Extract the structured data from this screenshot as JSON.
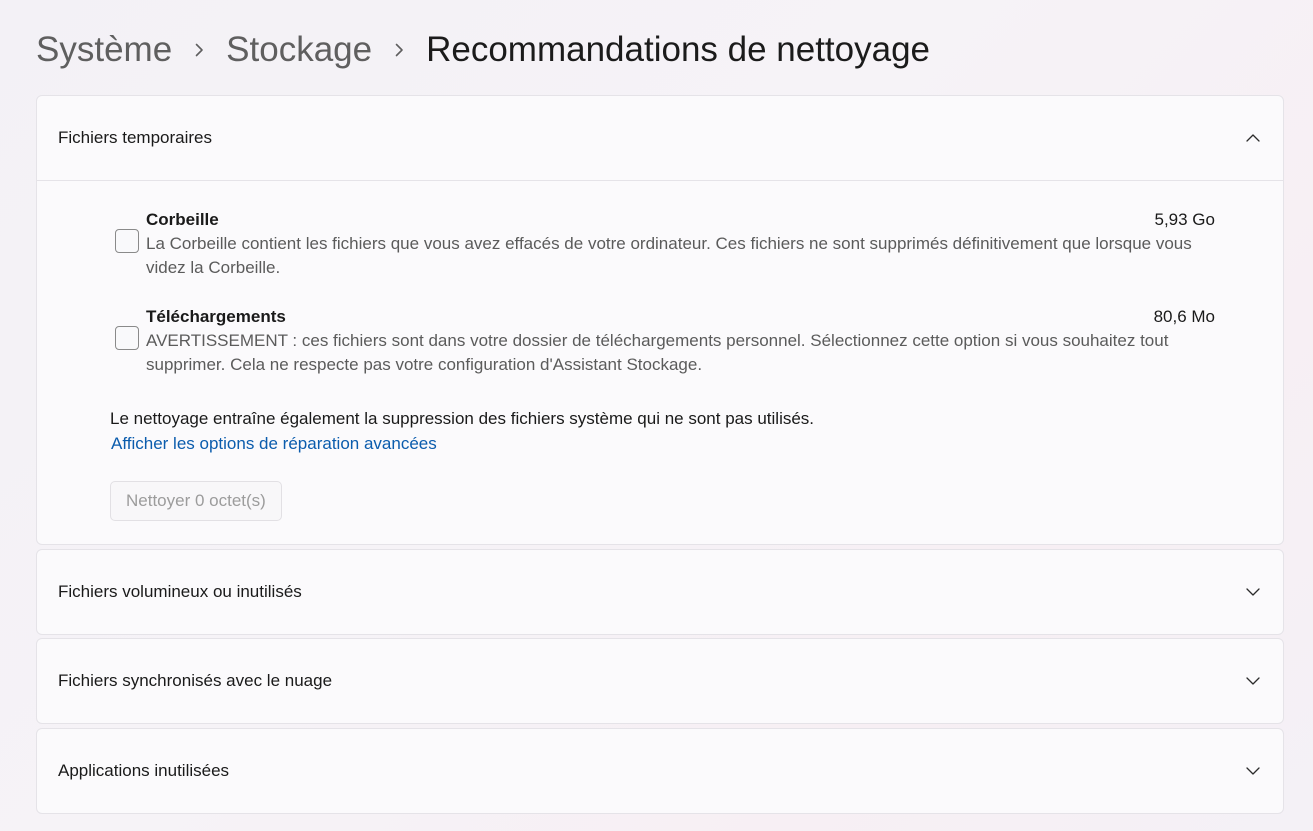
{
  "breadcrumb": {
    "items": [
      "Système",
      "Stockage",
      "Recommandations de nettoyage"
    ],
    "separator_icon": "chevron-right-icon"
  },
  "sections": [
    {
      "title": "Fichiers temporaires",
      "expanded": true,
      "items": [
        {
          "title": "Corbeille",
          "size": "5,93 Go",
          "description_lines": [
            "La Corbeille contient les fichiers que vous avez effacés de votre ordinateur. Ces fichiers ne sont supprimés définitivement que lorsque vous",
            "videz la Corbeille."
          ],
          "checked": false
        },
        {
          "title": "Téléchargements",
          "size": "80,6 Mo",
          "description_lines": [
            "AVERTISSEMENT : ces fichiers sont dans votre dossier de téléchargements personnel. Sélectionnez cette option si vous souhaitez tout",
            "supprimer. Cela ne respecte pas votre configuration d'Assistant Stockage."
          ],
          "checked": false
        }
      ],
      "note": "Le nettoyage entraîne également la suppression des fichiers système qui ne sont pas utilisés.",
      "link": "Afficher les options de réparation avancées",
      "button": "Nettoyer 0 octet(s)"
    },
    {
      "title": "Fichiers volumineux ou inutilisés",
      "expanded": false
    },
    {
      "title": "Fichiers synchronisés avec le nuage",
      "expanded": false
    },
    {
      "title": "Applications inutilisées",
      "expanded": false
    }
  ],
  "colors": {
    "accent_link": "#0b5cad",
    "card_background": "#fbfafc",
    "disabled_text": "#9c9c9c"
  }
}
